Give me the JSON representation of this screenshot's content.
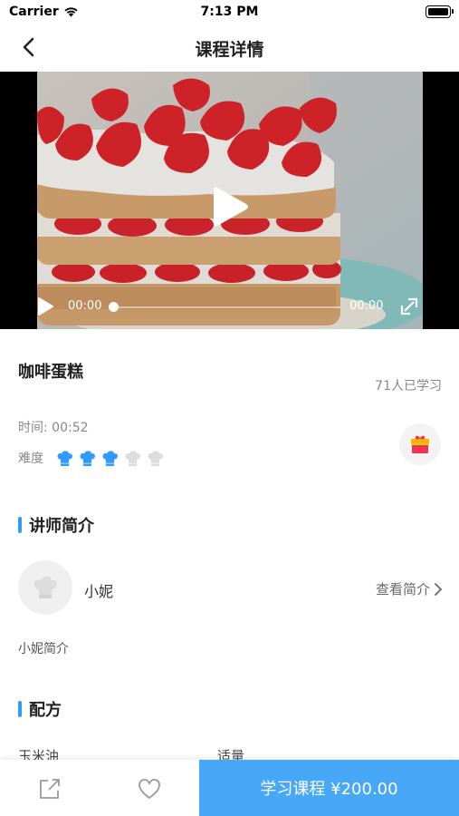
{
  "status_bar": {
    "carrier": "Carrier",
    "time": "7:13 PM"
  },
  "nav": {
    "title": "课程详情",
    "back_icon": "chevron-left-icon"
  },
  "video": {
    "current_time": "00:00",
    "total_time": "00:00",
    "progress": 0,
    "thumbnail": "strawberry-cream-cake"
  },
  "course": {
    "name": "咖啡蛋糕",
    "learners": "71人已学习",
    "time_label": "时间: 00:52",
    "difficulty_label": "难度",
    "difficulty_level": 3,
    "difficulty_max": 5
  },
  "teacher_section": {
    "title": "讲师简介",
    "name": "小妮",
    "view_link": "查看简介",
    "intro": "小妮简介"
  },
  "recipe_section": {
    "title": "配方",
    "items": [
      {
        "name": "玉米油",
        "amount": "适量"
      }
    ]
  },
  "bottom": {
    "buy_label": "学习课程 ¥200.00"
  },
  "colors": {
    "accent": "#2f9bff",
    "buy_button": "#48a8f8",
    "hat_active": "#2f9bff",
    "hat_inactive": "#dddddd"
  }
}
